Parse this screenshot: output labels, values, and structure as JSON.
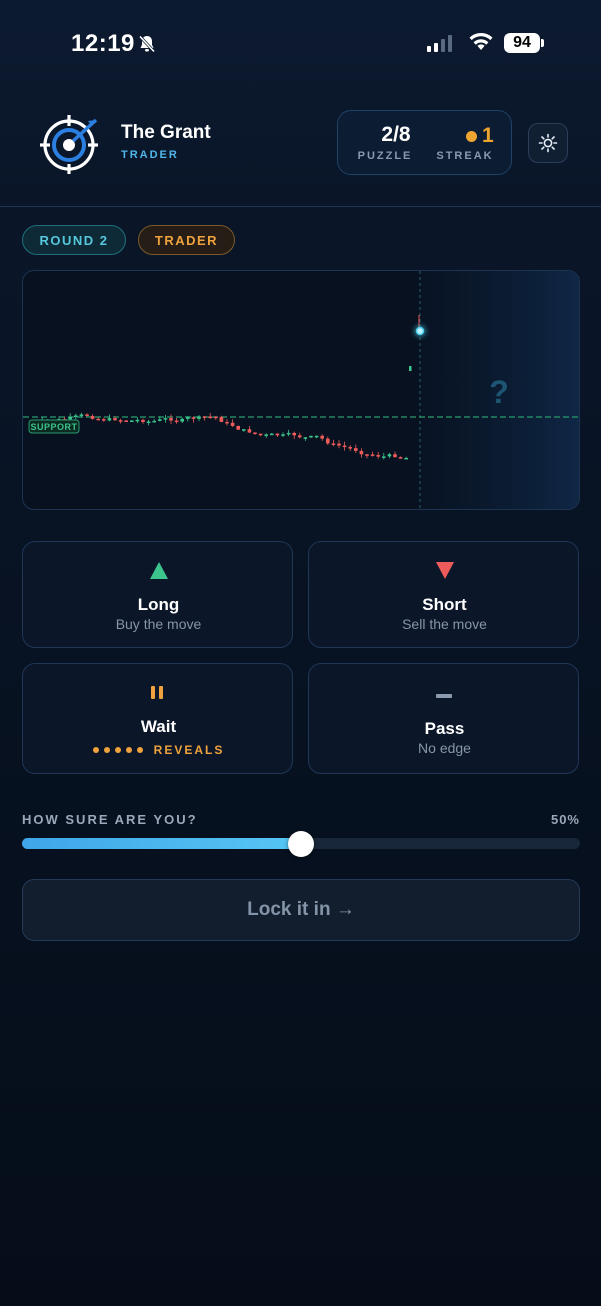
{
  "status_bar": {
    "time": "12:19",
    "battery": "94"
  },
  "header": {
    "app_name": "The Grant",
    "app_subtitle": "TRADER",
    "puzzle_value": "2/8",
    "puzzle_label": "PUZZLE",
    "streak_value": "1",
    "streak_label": "STREAK"
  },
  "badges": {
    "round": "ROUND 2",
    "level": "TRADER"
  },
  "chart": {
    "support_label": "SUPPORT",
    "unknown_marker": "?"
  },
  "actions": {
    "long": {
      "title": "Long",
      "subtitle": "Buy the move"
    },
    "short": {
      "title": "Short",
      "subtitle": "Sell the move"
    },
    "wait": {
      "title": "Wait",
      "subtitle": "REVEALS",
      "reveals_dots": 5
    },
    "pass": {
      "title": "Pass",
      "subtitle": "No edge"
    }
  },
  "confidence": {
    "label": "HOW SURE ARE YOU?",
    "value_text": "50%",
    "value": 0.5
  },
  "lock_button": {
    "label": "Lock it in →"
  },
  "colors": {
    "up": "#3cc58d",
    "down": "#ee5b5b",
    "accent": "#4fb7e8",
    "warn": "#efa23d"
  },
  "icons": [
    "bell-slash-icon",
    "signal-icon",
    "wifi-icon",
    "battery-icon",
    "target-logo-icon",
    "sun-gear-icon",
    "arrow-up-icon",
    "arrow-down-icon",
    "pause-icon",
    "minus-icon"
  ]
}
